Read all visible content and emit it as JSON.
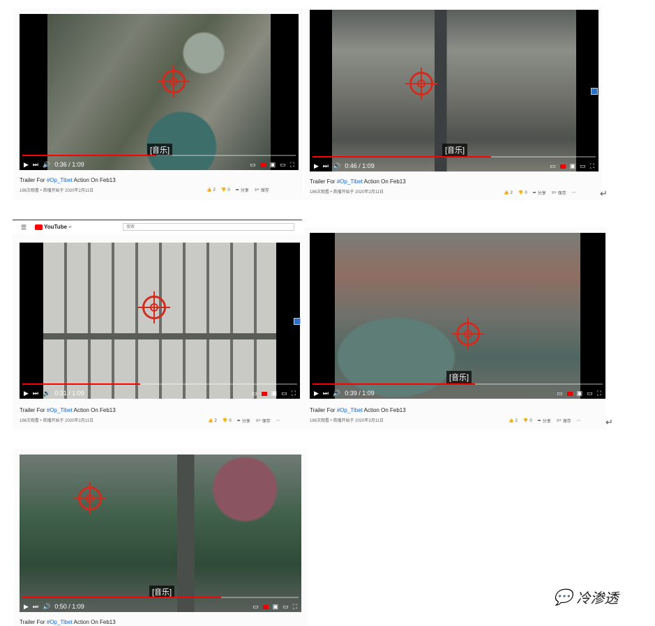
{
  "caption_text": "[音乐]",
  "videos": [
    {
      "time": "0:36 / 1:09",
      "progress": 0.49,
      "title_prefix": "Trailer For ",
      "title_tag": "#Op_Tibet",
      "title_suffix": " Action On Feb13",
      "meta": "186次观看 • 首播开始于 2020年2月11日",
      "likes": "2",
      "dislikes": "0",
      "share": "分享",
      "save": "保存"
    },
    {
      "time": "0:46 / 1:09",
      "progress": 0.63,
      "title_prefix": "Trailer For ",
      "title_tag": "#Op_Tibet",
      "title_suffix": " Action On Feb13",
      "meta": "186次观看 • 首播开始于 2020年2月11日",
      "likes": "2",
      "dislikes": "0",
      "share": "分享",
      "save": "保存"
    },
    {
      "time": "0:31 / 1:09",
      "progress": 0.43,
      "title_prefix": "Trailer For ",
      "title_tag": "#Op_Tibet",
      "title_suffix": " Action On Feb13",
      "meta": "186次观看 • 首播开始于 2020年2月11日",
      "likes": "2",
      "dislikes": "0",
      "share": "分享",
      "save": "保存"
    },
    {
      "time": "0:39 / 1:09",
      "progress": 0.56,
      "title_prefix": "Trailer For ",
      "title_tag": "#Op_Tibet",
      "title_suffix": " Action On Feb13",
      "meta": "186次观看 • 首播开始于 2020年2月11日",
      "likes": "2",
      "dislikes": "0",
      "share": "分享",
      "save": "保存"
    },
    {
      "time": "0:50 / 1:09",
      "progress": 0.72,
      "title_prefix": "Trailer For ",
      "title_tag": "#Op_Tibet",
      "title_suffix": " Action On Feb13"
    }
  ],
  "youtube_header": {
    "logo_text": "YouTube",
    "logo_sup": "JP",
    "search_placeholder": "搜索"
  },
  "watermark": "冷渗透",
  "colors": {
    "accent_red": "#d42a1e",
    "progress_red": "#ff0000",
    "tag_blue": "#1a66cc"
  },
  "icons": {
    "play": "play-icon",
    "next": "next-icon",
    "volume": "volume-icon",
    "subtitles": "subtitles-icon",
    "settings": "gear-icon",
    "miniplayer": "miniplayer-icon",
    "theater": "theater-icon",
    "fullscreen": "fullscreen-icon",
    "like": "thumbs-up-icon",
    "dislike": "thumbs-down-icon",
    "share": "share-icon",
    "save": "save-playlist-icon",
    "more": "more-icon",
    "return": "return-arrow-icon",
    "wechat": "wechat-icon"
  }
}
